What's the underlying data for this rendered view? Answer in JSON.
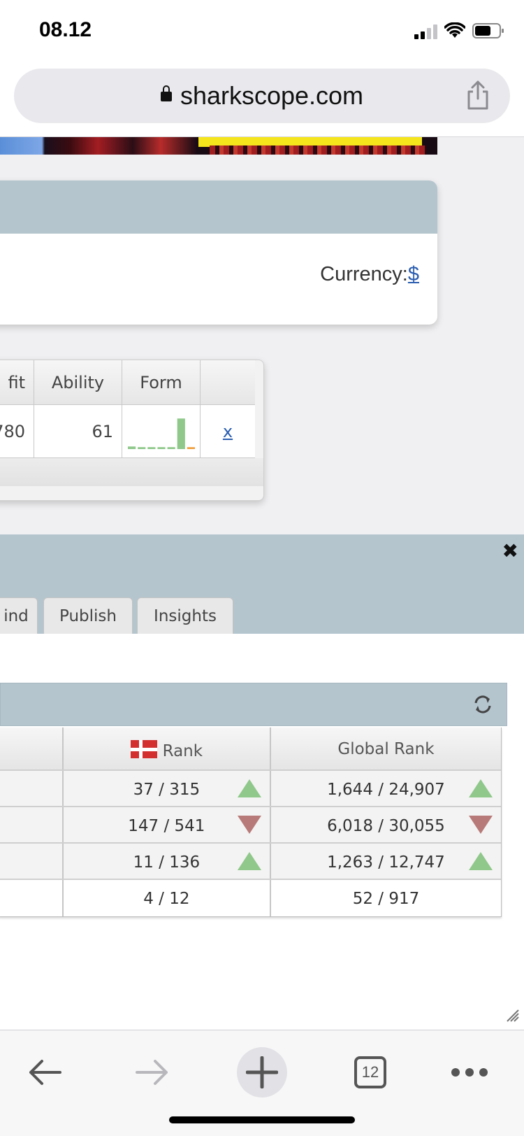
{
  "status_bar": {
    "time": "08.12",
    "icons": [
      "cellular-signal-icon",
      "wifi-icon",
      "battery-icon"
    ]
  },
  "browser": {
    "url": "sharkscope.com",
    "icons": [
      "lock-icon",
      "share-icon"
    ]
  },
  "currency": {
    "label": "Currency:",
    "value": "$"
  },
  "summary_table": {
    "headers": [
      "fit",
      "Ability",
      "Form",
      ""
    ],
    "row": {
      "profit": "780",
      "ability": "61",
      "remove_link": "x"
    },
    "form_bars": [
      {
        "level": 0.08,
        "color": "#8fc88a"
      },
      {
        "level": 0.06,
        "color": "#8fc88a"
      },
      {
        "level": 0.06,
        "color": "#8fc88a"
      },
      {
        "level": 0.06,
        "color": "#8fc88a"
      },
      {
        "level": 0.06,
        "color": "#8fc88a"
      },
      {
        "level": 0.95,
        "color": "#8fc88a"
      },
      {
        "level": 0.06,
        "color": "#f0a040"
      }
    ]
  },
  "panel": {
    "close_icon": "close-icon",
    "tabs": [
      {
        "label": "ind"
      },
      {
        "label": "Publish"
      },
      {
        "label": "Insights"
      }
    ]
  },
  "rank_table": {
    "refresh_icon": "refresh-icon",
    "headers": {
      "national": "Rank",
      "global": "Global Rank",
      "flag_icon": "denmark-flag-icon"
    },
    "rows": [
      {
        "national": "37 / 315",
        "national_trend": "up",
        "global": "1,644 / 24,907",
        "global_trend": "up"
      },
      {
        "national": "147 / 541",
        "national_trend": "down",
        "global": "6,018 / 30,055",
        "global_trend": "down"
      },
      {
        "national": "11 / 136",
        "national_trend": "up",
        "global": "1,263 / 12,747",
        "global_trend": "up"
      },
      {
        "national": "4 / 12",
        "national_trend": "",
        "global": "52 / 917",
        "global_trend": ""
      }
    ],
    "trend_colors": {
      "up": "#8fc88a",
      "down": "#b77a78"
    }
  },
  "toolbar": {
    "tab_count": "12",
    "icons": [
      "back-arrow-icon",
      "forward-arrow-icon",
      "new-tab-icon",
      "tabs-icon",
      "more-icon"
    ]
  }
}
